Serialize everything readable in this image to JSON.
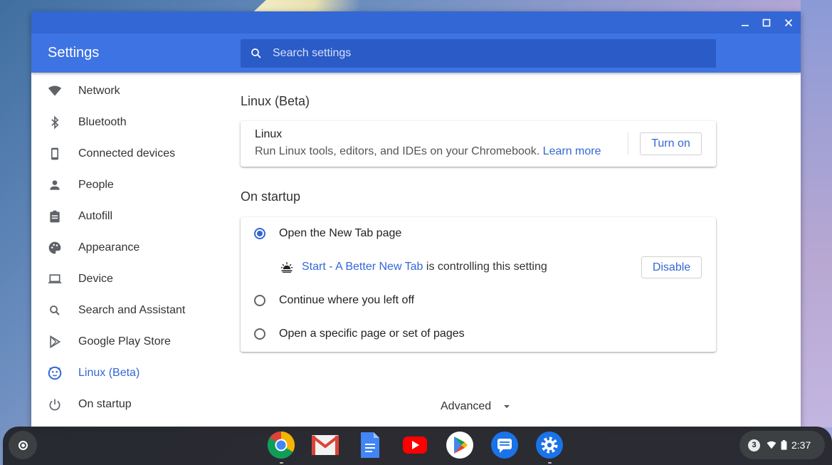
{
  "window": {
    "controls": [
      "minimize-icon",
      "maximize-icon",
      "close-icon"
    ]
  },
  "header": {
    "title": "Settings",
    "search_placeholder": "Search settings"
  },
  "sidebar": {
    "items": [
      {
        "label": "Network",
        "icon": "wifi-icon"
      },
      {
        "label": "Bluetooth",
        "icon": "bluetooth-icon"
      },
      {
        "label": "Connected devices",
        "icon": "phone-icon"
      },
      {
        "label": "People",
        "icon": "person-icon"
      },
      {
        "label": "Autofill",
        "icon": "clipboard-icon"
      },
      {
        "label": "Appearance",
        "icon": "palette-icon"
      },
      {
        "label": "Device",
        "icon": "laptop-icon"
      },
      {
        "label": "Search and Assistant",
        "icon": "search-icon"
      },
      {
        "label": "Google Play Store",
        "icon": "play-store-icon"
      },
      {
        "label": "Linux (Beta)",
        "icon": "linux-penguin-icon",
        "active": true
      },
      {
        "label": "On startup",
        "icon": "power-icon"
      }
    ]
  },
  "linux_section": {
    "title": "Linux (Beta)",
    "card_title": "Linux",
    "description": "Run Linux tools, editors, and IDEs on your Chromebook.",
    "learn_more": "Learn more",
    "turn_on_label": "Turn on"
  },
  "startup_section": {
    "title": "On startup",
    "options": [
      {
        "label": "Open the New Tab page",
        "selected": true
      },
      {
        "label": "Continue where you left off",
        "selected": false
      },
      {
        "label": "Open a specific page or set of pages",
        "selected": false
      }
    ],
    "controlling_extension": "Start - A Better New Tab",
    "controlling_text": "is controlling this setting",
    "disable_label": "Disable"
  },
  "advanced_label": "Advanced",
  "shelf": {
    "apps": [
      "chrome-icon",
      "gmail-icon",
      "docs-icon",
      "youtube-icon",
      "play-store-icon",
      "messages-icon",
      "settings-icon"
    ],
    "notification_count": "3",
    "time": "2:37"
  },
  "colors": {
    "accent": "#3367d6",
    "header": "#3e73e3",
    "titlebar": "#3367d6"
  }
}
